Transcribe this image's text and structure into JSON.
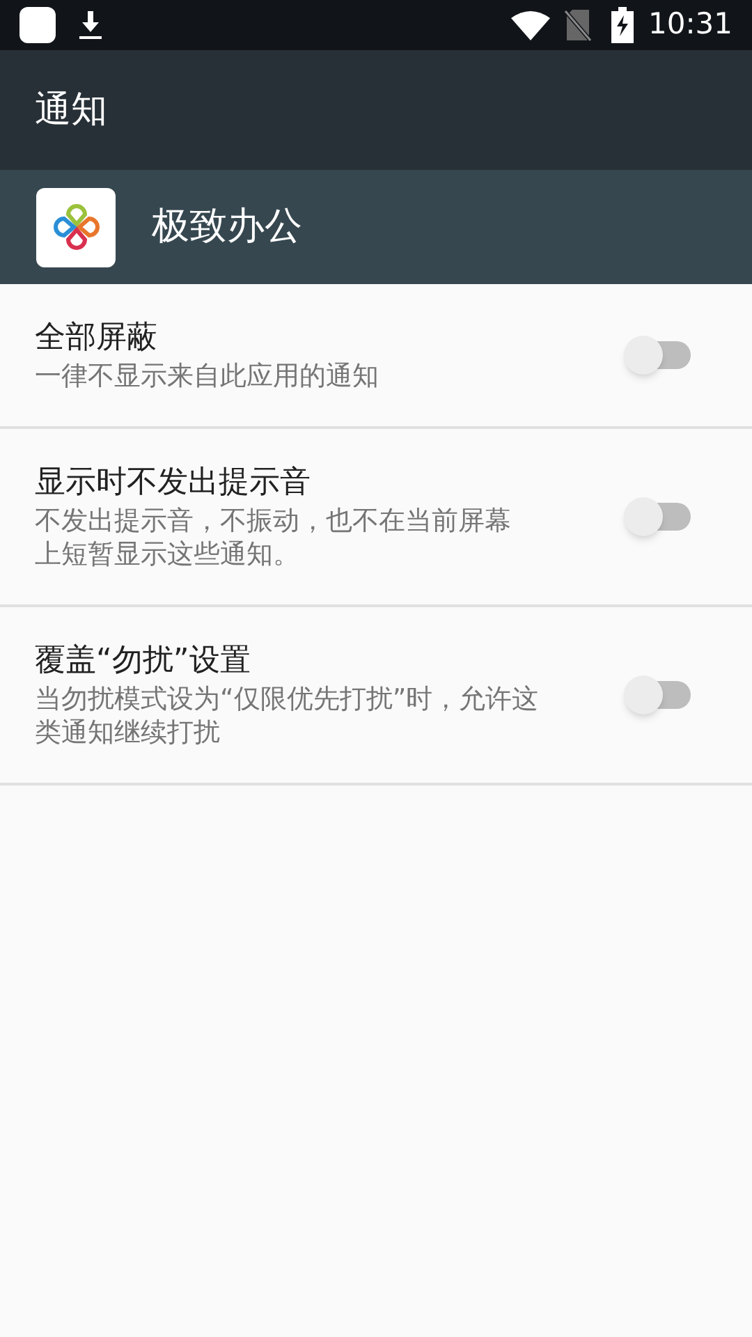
{
  "status_bar": {
    "time": "10:31"
  },
  "app_bar": {
    "title": "通知"
  },
  "app_header": {
    "name": "极致办公"
  },
  "settings": [
    {
      "title": "全部屏蔽",
      "description_lines": [
        "一律不显示来自此应用的通知"
      ],
      "on": false
    },
    {
      "title": "显示时不发出提示音",
      "description_lines": [
        "不发出提示音，不振动，也不在当前屏幕",
        "上短暂显示这些通知。"
      ],
      "on": false
    },
    {
      "title": "覆盖“勿扰”设置",
      "description_lines": [
        "当勿扰模式设为“仅限优先打扰”时，允许这",
        "类通知继续打扰"
      ],
      "on": false
    }
  ]
}
